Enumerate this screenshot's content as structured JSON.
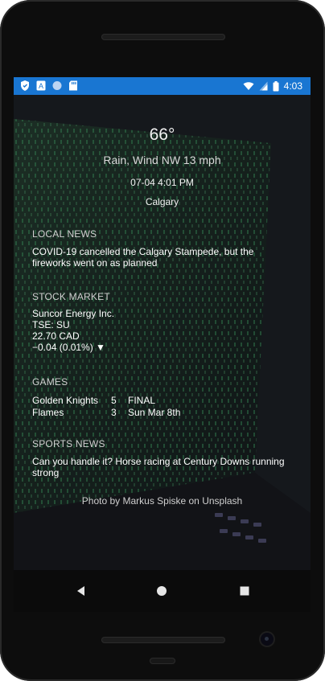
{
  "status_bar": {
    "time": "4:03",
    "left_icons": [
      "shield-icon",
      "a-badge-icon",
      "circle-icon",
      "sd-card-icon"
    ],
    "right_icons": [
      "wifi-icon",
      "signal-icon",
      "battery-icon"
    ],
    "color": "#1976d2"
  },
  "weather": {
    "temperature": "66°",
    "condition": "Rain, Wind NW 13 mph",
    "datetime": "07-04 4:01 PM",
    "city": "Calgary"
  },
  "local_news": {
    "title": "LOCAL NEWS",
    "headline": "COVID-19 cancelled the Calgary Stampede, but the fireworks went on as planned"
  },
  "stock_market": {
    "title": "STOCK MARKET",
    "company": "Suncor Energy Inc.",
    "ticker": "TSE: SU",
    "price": "22.70 CAD",
    "change": "−0.04 (0.01%) ▼"
  },
  "games": {
    "title": "GAMES",
    "rows": [
      {
        "team": "Golden Knights",
        "score": "5",
        "status": "FINAL"
      },
      {
        "team": "Flames",
        "score": "3",
        "status": "Sun Mar 8th"
      }
    ]
  },
  "sports_news": {
    "title": "SPORTS NEWS",
    "headline": "Can you handle it? Horse racing at Century Downs running strong"
  },
  "photo_credit": "Photo by Markus Spiske on Unsplash",
  "nav": {
    "icons": [
      "back-icon",
      "home-icon",
      "recents-icon"
    ]
  }
}
